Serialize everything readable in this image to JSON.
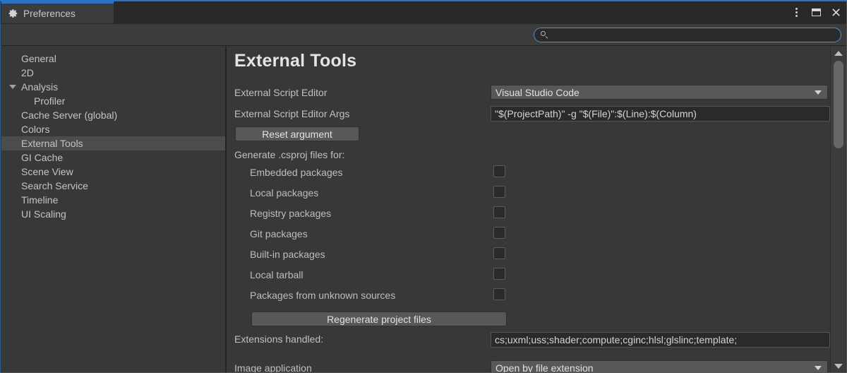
{
  "window": {
    "tab_label": "Preferences",
    "tab_icon": "gear-icon",
    "controls": {
      "menu": "more-vertical-icon",
      "maximize": "maximize-icon",
      "close": "close-icon"
    },
    "accent_color": "#2b72c4",
    "background_color": "#383838"
  },
  "search": {
    "icon": "search-icon",
    "value": "",
    "placeholder": ""
  },
  "sidebar": {
    "items": [
      {
        "label": "General",
        "indent": false,
        "expandable": false,
        "selected": false
      },
      {
        "label": "2D",
        "indent": false,
        "expandable": false,
        "selected": false
      },
      {
        "label": "Analysis",
        "indent": false,
        "expandable": true,
        "selected": false
      },
      {
        "label": "Profiler",
        "indent": true,
        "expandable": false,
        "selected": false
      },
      {
        "label": "Cache Server (global)",
        "indent": false,
        "expandable": false,
        "selected": false
      },
      {
        "label": "Colors",
        "indent": false,
        "expandable": false,
        "selected": false
      },
      {
        "label": "External Tools",
        "indent": false,
        "expandable": false,
        "selected": true
      },
      {
        "label": "GI Cache",
        "indent": false,
        "expandable": false,
        "selected": false
      },
      {
        "label": "Scene View",
        "indent": false,
        "expandable": false,
        "selected": false
      },
      {
        "label": "Search Service",
        "indent": false,
        "expandable": false,
        "selected": false
      },
      {
        "label": "Timeline",
        "indent": false,
        "expandable": false,
        "selected": false
      },
      {
        "label": "UI Scaling",
        "indent": false,
        "expandable": false,
        "selected": false
      }
    ]
  },
  "main": {
    "title": "External Tools",
    "script_editor": {
      "label": "External Script Editor",
      "value": "Visual Studio Code"
    },
    "script_editor_args": {
      "label": "External Script Editor Args",
      "value": "\"$(ProjectPath)\" -g \"$(File)\":$(Line):$(Column)"
    },
    "reset_argument_button": "Reset argument",
    "csproj_section_label": "Generate .csproj files for:",
    "csproj_options": [
      {
        "label": "Embedded packages",
        "checked": false
      },
      {
        "label": "Local packages",
        "checked": false
      },
      {
        "label": "Registry packages",
        "checked": false
      },
      {
        "label": "Git packages",
        "checked": false
      },
      {
        "label": "Built-in packages",
        "checked": false
      },
      {
        "label": "Local tarball",
        "checked": false
      },
      {
        "label": "Packages from unknown sources",
        "checked": false
      }
    ],
    "regenerate_button": "Regenerate project files",
    "extensions": {
      "label": "Extensions handled:",
      "value": "cs;uxml;uss;shader;compute;cginc;hlsl;glslinc;template;"
    },
    "image_application": {
      "label": "Image application",
      "value": "Open by file extension"
    }
  },
  "scrollbar": {
    "up_arrow": "scroll-up-icon",
    "down_arrow": "scroll-down-icon"
  }
}
